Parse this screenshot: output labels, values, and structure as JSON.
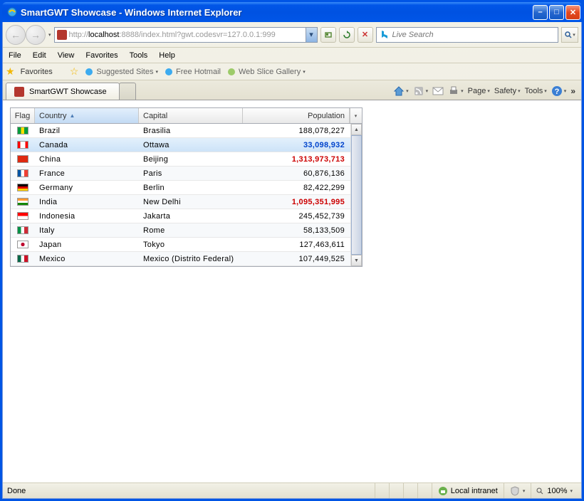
{
  "window": {
    "title": "SmartGWT Showcase - Windows Internet Explorer"
  },
  "address": {
    "prefix": "http://",
    "host": "localhost",
    "rest": ":8888/index.html?gwt.codesvr=127.0.0.1:999"
  },
  "search": {
    "placeholder": "Live Search"
  },
  "menus": [
    "File",
    "Edit",
    "View",
    "Favorites",
    "Tools",
    "Help"
  ],
  "favorites": {
    "label": "Favorites",
    "suggested": "Suggested Sites",
    "hotmail": "Free Hotmail",
    "webslice": "Web Slice Gallery"
  },
  "tab": {
    "title": "SmartGWT Showcase"
  },
  "tools": {
    "page": "Page",
    "safety": "Safety",
    "tools": "Tools"
  },
  "grid": {
    "headers": {
      "flag": "Flag",
      "country": "Country",
      "capital": "Capital",
      "population": "Population"
    },
    "rows": [
      {
        "country": "Brazil",
        "capital": "Brasilia",
        "population": "188,078,227",
        "flag_bg": "linear-gradient(to right,#009c3b 33%,#ffdf00 33%,#ffdf00 66%,#009c3b 66%)",
        "pop_class": ""
      },
      {
        "country": "Canada",
        "capital": "Ottawa",
        "population": "33,098,932",
        "flag_bg": "linear-gradient(to right,#ff0000 25%,#fff 25%,#fff 75%,#ff0000 75%)",
        "pop_class": "blue",
        "selected": true
      },
      {
        "country": "China",
        "capital": "Beijing",
        "population": "1,313,973,713",
        "flag_bg": "#de2910",
        "pop_class": "red"
      },
      {
        "country": "France",
        "capital": "Paris",
        "population": "60,876,136",
        "flag_bg": "linear-gradient(to right,#0055a4 33%,#fff 33%,#fff 66%,#ef4135 66%)",
        "pop_class": ""
      },
      {
        "country": "Germany",
        "capital": "Berlin",
        "population": "82,422,299",
        "flag_bg": "linear-gradient(to bottom,#000 33%,#dd0000 33%,#dd0000 66%,#ffce00 66%)",
        "pop_class": ""
      },
      {
        "country": "India",
        "capital": "New Delhi",
        "population": "1,095,351,995",
        "flag_bg": "linear-gradient(to bottom,#ff9933 33%,#fff 33%,#fff 66%,#138808 66%)",
        "pop_class": "red"
      },
      {
        "country": "Indonesia",
        "capital": "Jakarta",
        "population": "245,452,739",
        "flag_bg": "linear-gradient(to bottom,#ff0000 50%,#fff 50%)",
        "pop_class": ""
      },
      {
        "country": "Italy",
        "capital": "Rome",
        "population": "58,133,509",
        "flag_bg": "linear-gradient(to right,#009246 33%,#fff 33%,#fff 66%,#ce2b37 66%)",
        "pop_class": ""
      },
      {
        "country": "Japan",
        "capital": "Tokyo",
        "population": "127,463,611",
        "flag_bg": "radial-gradient(circle at center,#bc002d 30%,#fff 32%)",
        "pop_class": ""
      },
      {
        "country": "Mexico",
        "capital": "Mexico (Distrito Federal)",
        "population": "107,449,525",
        "flag_bg": "linear-gradient(to right,#006847 33%,#fff 33%,#fff 66%,#ce1126 66%)",
        "pop_class": ""
      }
    ]
  },
  "status": {
    "left": "Done",
    "zone": "Local intranet",
    "zoom": "100%"
  }
}
